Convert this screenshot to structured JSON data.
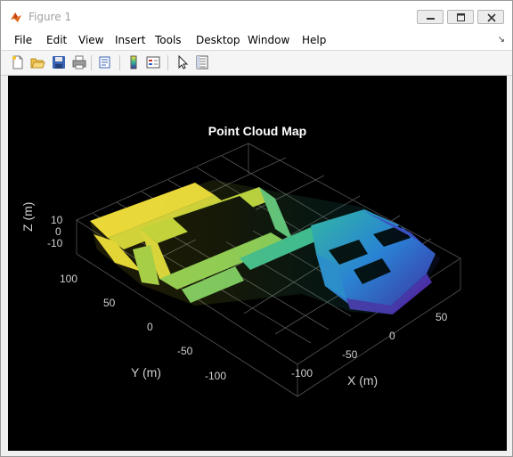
{
  "window": {
    "title": "Figure 1"
  },
  "menu": [
    "File",
    "Edit",
    "View",
    "Insert",
    "Tools",
    "Desktop",
    "Window",
    "Help"
  ],
  "toolbar": {
    "buttons": [
      "new-figure",
      "open-file",
      "save",
      "print",
      "print-preview",
      "insert-colorbar",
      "insert-legend",
      "edit-plot",
      "property-inspector"
    ]
  },
  "plot": {
    "title": "Point Cloud Map",
    "xlabel": "X (m)",
    "ylabel": "Y (m)",
    "zlabel": "Z (m)",
    "xticks": [
      "-100",
      "-50",
      "0",
      "50"
    ],
    "yticks": [
      "100",
      "50",
      "0",
      "-50",
      "-100"
    ],
    "zticks": [
      "10",
      "0",
      "-10"
    ],
    "colormap": "parula",
    "background": "#000000"
  }
}
